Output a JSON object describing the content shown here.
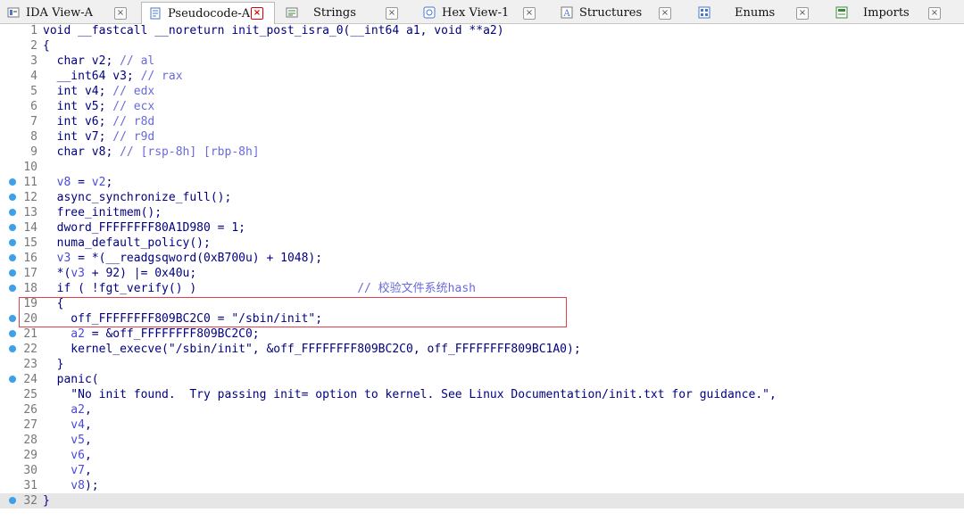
{
  "tabs": [
    {
      "label": "IDA View-A",
      "icon": "ida-view-icon",
      "active": false
    },
    {
      "label": "Pseudocode-A",
      "icon": "pseudocode-icon",
      "active": true
    },
    {
      "label": "Strings",
      "icon": "strings-icon",
      "active": false
    },
    {
      "label": "Hex View-1",
      "icon": "hex-view-icon",
      "active": false
    },
    {
      "label": "Structures",
      "icon": "structures-icon",
      "active": false
    },
    {
      "label": "Enums",
      "icon": "enums-icon",
      "active": false
    },
    {
      "label": "Imports",
      "icon": "imports-icon",
      "active": false
    }
  ],
  "code_lines": [
    {
      "num": "1",
      "bp": false,
      "segs": [
        [
          "kw",
          "void __fastcall __noreturn init_post_isra_0(__int64 a1, void **a2)"
        ]
      ]
    },
    {
      "num": "2",
      "bp": false,
      "segs": [
        [
          "kw",
          "{"
        ]
      ]
    },
    {
      "num": "3",
      "bp": false,
      "segs": [
        [
          "kw",
          "  char v2; "
        ],
        [
          "cm",
          "// al"
        ]
      ]
    },
    {
      "num": "4",
      "bp": false,
      "segs": [
        [
          "kw",
          "  __int64 v3; "
        ],
        [
          "cm",
          "// rax"
        ]
      ]
    },
    {
      "num": "5",
      "bp": false,
      "segs": [
        [
          "kw",
          "  int v4; "
        ],
        [
          "cm",
          "// edx"
        ]
      ]
    },
    {
      "num": "6",
      "bp": false,
      "segs": [
        [
          "kw",
          "  int v5; "
        ],
        [
          "cm",
          "// ecx"
        ]
      ]
    },
    {
      "num": "7",
      "bp": false,
      "segs": [
        [
          "kw",
          "  int v6; "
        ],
        [
          "cm",
          "// r8d"
        ]
      ]
    },
    {
      "num": "8",
      "bp": false,
      "segs": [
        [
          "kw",
          "  int v7; "
        ],
        [
          "cm",
          "// r9d"
        ]
      ]
    },
    {
      "num": "9",
      "bp": false,
      "segs": [
        [
          "kw",
          "  char v8; "
        ],
        [
          "cm",
          "// [rsp-8h] [rbp-8h]"
        ]
      ]
    },
    {
      "num": "10",
      "bp": false,
      "segs": []
    },
    {
      "num": "11",
      "bp": true,
      "segs": [
        [
          "vr",
          "  v8"
        ],
        [
          "kw",
          " = "
        ],
        [
          "vr",
          "v2"
        ],
        [
          "kw",
          ";"
        ]
      ]
    },
    {
      "num": "12",
      "bp": true,
      "segs": [
        [
          "kw",
          "  async_synchronize_full();"
        ]
      ]
    },
    {
      "num": "13",
      "bp": true,
      "segs": [
        [
          "kw",
          "  free_initmem();"
        ]
      ]
    },
    {
      "num": "14",
      "bp": true,
      "segs": [
        [
          "kw",
          "  dword_FFFFFFFF80A1D980 = 1;"
        ]
      ]
    },
    {
      "num": "15",
      "bp": true,
      "segs": [
        [
          "kw",
          "  numa_default_policy();"
        ]
      ]
    },
    {
      "num": "16",
      "bp": true,
      "segs": [
        [
          "vr",
          "  v3"
        ],
        [
          "kw",
          " = *(__readgsqword(0xB700u) + 1048);"
        ]
      ]
    },
    {
      "num": "17",
      "bp": true,
      "segs": [
        [
          "kw",
          "  *("
        ],
        [
          "vr",
          "v3"
        ],
        [
          "kw",
          " + 92) |= 0x40u;"
        ]
      ]
    },
    {
      "num": "18",
      "bp": true,
      "segs": [
        [
          "kw",
          "  if ( !fgt_verify() )                       "
        ],
        [
          "cm",
          "// 校验文件系统hash"
        ]
      ]
    },
    {
      "num": "19",
      "bp": false,
      "segs": [
        [
          "kw",
          "  {"
        ]
      ]
    },
    {
      "num": "20",
      "bp": true,
      "segs": [
        [
          "kw",
          "    off_FFFFFFFF809BC2C0 = \"/sbin/init\";"
        ]
      ]
    },
    {
      "num": "21",
      "bp": true,
      "segs": [
        [
          "vr",
          "    a2"
        ],
        [
          "kw",
          " = &off_FFFFFFFF809BC2C0;"
        ]
      ]
    },
    {
      "num": "22",
      "bp": true,
      "segs": [
        [
          "kw",
          "    kernel_execve(\"/sbin/init\", &off_FFFFFFFF809BC2C0, off_FFFFFFFF809BC1A0);"
        ]
      ]
    },
    {
      "num": "23",
      "bp": false,
      "segs": [
        [
          "kw",
          "  }"
        ]
      ]
    },
    {
      "num": "24",
      "bp": true,
      "segs": [
        [
          "kw",
          "  panic("
        ]
      ]
    },
    {
      "num": "25",
      "bp": false,
      "segs": [
        [
          "kw",
          "    \"No init found.  Try passing init= option to kernel. See Linux Documentation/init.txt for guidance.\","
        ]
      ]
    },
    {
      "num": "26",
      "bp": false,
      "segs": [
        [
          "vr",
          "    a2"
        ],
        [
          "kw",
          ","
        ]
      ]
    },
    {
      "num": "27",
      "bp": false,
      "segs": [
        [
          "vr",
          "    v4"
        ],
        [
          "kw",
          ","
        ]
      ]
    },
    {
      "num": "28",
      "bp": false,
      "segs": [
        [
          "vr",
          "    v5"
        ],
        [
          "kw",
          ","
        ]
      ]
    },
    {
      "num": "29",
      "bp": false,
      "segs": [
        [
          "vr",
          "    v6"
        ],
        [
          "kw",
          ","
        ]
      ]
    },
    {
      "num": "30",
      "bp": false,
      "segs": [
        [
          "vr",
          "    v7"
        ],
        [
          "kw",
          ","
        ]
      ]
    },
    {
      "num": "31",
      "bp": false,
      "segs": [
        [
          "vr",
          "    v8"
        ],
        [
          "kw",
          ");"
        ]
      ]
    },
    {
      "num": "32",
      "bp": true,
      "segs": [
        [
          "kw",
          "}"
        ]
      ]
    }
  ],
  "colors": {
    "keyword": "#000080",
    "comment": "#6a6ad8",
    "variable": "#4a4ad8",
    "breakpoint": "#3da0e8",
    "highlight_box": "#e0404a"
  }
}
